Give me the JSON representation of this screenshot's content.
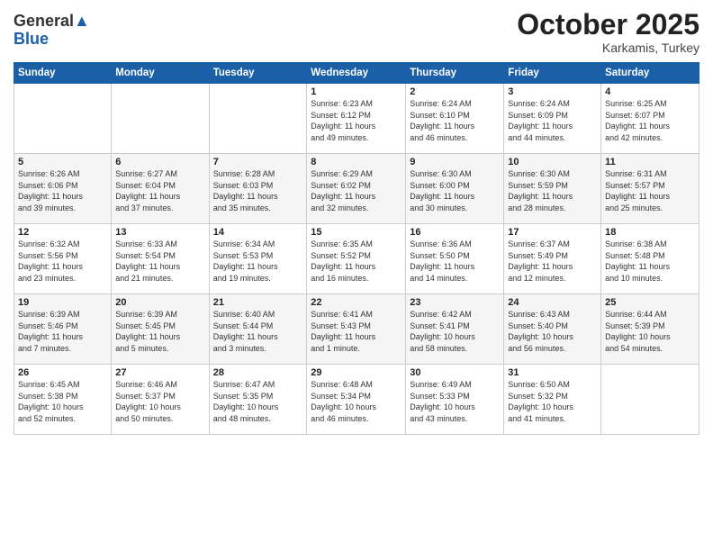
{
  "header": {
    "logo_line1": "General",
    "logo_line2": "Blue",
    "month": "October 2025",
    "location": "Karkamis, Turkey"
  },
  "weekdays": [
    "Sunday",
    "Monday",
    "Tuesday",
    "Wednesday",
    "Thursday",
    "Friday",
    "Saturday"
  ],
  "weeks": [
    [
      {
        "day": "",
        "info": ""
      },
      {
        "day": "",
        "info": ""
      },
      {
        "day": "",
        "info": ""
      },
      {
        "day": "1",
        "info": "Sunrise: 6:23 AM\nSunset: 6:12 PM\nDaylight: 11 hours\nand 49 minutes."
      },
      {
        "day": "2",
        "info": "Sunrise: 6:24 AM\nSunset: 6:10 PM\nDaylight: 11 hours\nand 46 minutes."
      },
      {
        "day": "3",
        "info": "Sunrise: 6:24 AM\nSunset: 6:09 PM\nDaylight: 11 hours\nand 44 minutes."
      },
      {
        "day": "4",
        "info": "Sunrise: 6:25 AM\nSunset: 6:07 PM\nDaylight: 11 hours\nand 42 minutes."
      }
    ],
    [
      {
        "day": "5",
        "info": "Sunrise: 6:26 AM\nSunset: 6:06 PM\nDaylight: 11 hours\nand 39 minutes."
      },
      {
        "day": "6",
        "info": "Sunrise: 6:27 AM\nSunset: 6:04 PM\nDaylight: 11 hours\nand 37 minutes."
      },
      {
        "day": "7",
        "info": "Sunrise: 6:28 AM\nSunset: 6:03 PM\nDaylight: 11 hours\nand 35 minutes."
      },
      {
        "day": "8",
        "info": "Sunrise: 6:29 AM\nSunset: 6:02 PM\nDaylight: 11 hours\nand 32 minutes."
      },
      {
        "day": "9",
        "info": "Sunrise: 6:30 AM\nSunset: 6:00 PM\nDaylight: 11 hours\nand 30 minutes."
      },
      {
        "day": "10",
        "info": "Sunrise: 6:30 AM\nSunset: 5:59 PM\nDaylight: 11 hours\nand 28 minutes."
      },
      {
        "day": "11",
        "info": "Sunrise: 6:31 AM\nSunset: 5:57 PM\nDaylight: 11 hours\nand 25 minutes."
      }
    ],
    [
      {
        "day": "12",
        "info": "Sunrise: 6:32 AM\nSunset: 5:56 PM\nDaylight: 11 hours\nand 23 minutes."
      },
      {
        "day": "13",
        "info": "Sunrise: 6:33 AM\nSunset: 5:54 PM\nDaylight: 11 hours\nand 21 minutes."
      },
      {
        "day": "14",
        "info": "Sunrise: 6:34 AM\nSunset: 5:53 PM\nDaylight: 11 hours\nand 19 minutes."
      },
      {
        "day": "15",
        "info": "Sunrise: 6:35 AM\nSunset: 5:52 PM\nDaylight: 11 hours\nand 16 minutes."
      },
      {
        "day": "16",
        "info": "Sunrise: 6:36 AM\nSunset: 5:50 PM\nDaylight: 11 hours\nand 14 minutes."
      },
      {
        "day": "17",
        "info": "Sunrise: 6:37 AM\nSunset: 5:49 PM\nDaylight: 11 hours\nand 12 minutes."
      },
      {
        "day": "18",
        "info": "Sunrise: 6:38 AM\nSunset: 5:48 PM\nDaylight: 11 hours\nand 10 minutes."
      }
    ],
    [
      {
        "day": "19",
        "info": "Sunrise: 6:39 AM\nSunset: 5:46 PM\nDaylight: 11 hours\nand 7 minutes."
      },
      {
        "day": "20",
        "info": "Sunrise: 6:39 AM\nSunset: 5:45 PM\nDaylight: 11 hours\nand 5 minutes."
      },
      {
        "day": "21",
        "info": "Sunrise: 6:40 AM\nSunset: 5:44 PM\nDaylight: 11 hours\nand 3 minutes."
      },
      {
        "day": "22",
        "info": "Sunrise: 6:41 AM\nSunset: 5:43 PM\nDaylight: 11 hours\nand 1 minute."
      },
      {
        "day": "23",
        "info": "Sunrise: 6:42 AM\nSunset: 5:41 PM\nDaylight: 10 hours\nand 58 minutes."
      },
      {
        "day": "24",
        "info": "Sunrise: 6:43 AM\nSunset: 5:40 PM\nDaylight: 10 hours\nand 56 minutes."
      },
      {
        "day": "25",
        "info": "Sunrise: 6:44 AM\nSunset: 5:39 PM\nDaylight: 10 hours\nand 54 minutes."
      }
    ],
    [
      {
        "day": "26",
        "info": "Sunrise: 6:45 AM\nSunset: 5:38 PM\nDaylight: 10 hours\nand 52 minutes."
      },
      {
        "day": "27",
        "info": "Sunrise: 6:46 AM\nSunset: 5:37 PM\nDaylight: 10 hours\nand 50 minutes."
      },
      {
        "day": "28",
        "info": "Sunrise: 6:47 AM\nSunset: 5:35 PM\nDaylight: 10 hours\nand 48 minutes."
      },
      {
        "day": "29",
        "info": "Sunrise: 6:48 AM\nSunset: 5:34 PM\nDaylight: 10 hours\nand 46 minutes."
      },
      {
        "day": "30",
        "info": "Sunrise: 6:49 AM\nSunset: 5:33 PM\nDaylight: 10 hours\nand 43 minutes."
      },
      {
        "day": "31",
        "info": "Sunrise: 6:50 AM\nSunset: 5:32 PM\nDaylight: 10 hours\nand 41 minutes."
      },
      {
        "day": "",
        "info": ""
      }
    ]
  ]
}
